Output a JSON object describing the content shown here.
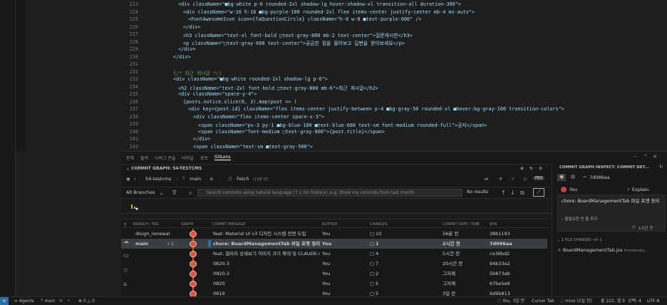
{
  "editor": {
    "lines": [
      {
        "n": "223",
        "indent": 6,
        "kind": "tagline",
        "text": "<div className=\"■bg-white p-6 rounded-2xl shadow-lg hover:shadow-xl transition-all duration-300\">"
      },
      {
        "n": "224",
        "indent": 7,
        "kind": "tagline",
        "text": "<div className=\"w-16 h-16 ■bg-purple-100 rounded-2xl flex items-center justify-center mb-4 mx-auto\">"
      },
      {
        "n": "225",
        "indent": 8,
        "kind": "tagline",
        "text": "<FontAwesomeIcon icon={faQuestionCircle} className=\"h-8 w-8 ■text-purple-600\" />"
      },
      {
        "n": "226",
        "indent": 7,
        "kind": "tagline",
        "text": "</div>"
      },
      {
        "n": "227",
        "indent": 7,
        "kind": "tagline",
        "text": "<h3 className=\"text-xl font-bold □text-gray-800 mb-2 text-center\">질문게시판</h3>"
      },
      {
        "n": "228",
        "indent": 7,
        "kind": "tagline",
        "text": "<p className=\"□text-gray-600 text-center\">궁금한 점을 물어보고 답변을 받아보세요</p>"
      },
      {
        "n": "229",
        "indent": 6,
        "kind": "tagline",
        "text": "</div>"
      },
      {
        "n": "230",
        "indent": 5,
        "kind": "tagline",
        "text": "</div>"
      },
      {
        "n": "231",
        "indent": 0,
        "kind": "blank",
        "text": ""
      },
      {
        "n": "232",
        "indent": 5,
        "kind": "comment",
        "text": "{/* 최근 게시글 */}"
      },
      {
        "n": "233",
        "indent": 5,
        "kind": "tagline",
        "text": "<div className=\"■bg-white rounded-2xl shadow-lg p-6\">"
      },
      {
        "n": "234",
        "indent": 6,
        "kind": "tagline",
        "text": "<h2 className=\"text-2xl font-bold □text-gray-800 mb-6\">최근 게시글</h2>"
      },
      {
        "n": "235",
        "indent": 6,
        "kind": "tagline",
        "text": "<div className=\"space-y-4\">"
      },
      {
        "n": "236",
        "indent": 7,
        "kind": "code",
        "text": "{posts.notice.slice(0, 3).map(post => ("
      },
      {
        "n": "237",
        "indent": 8,
        "kind": "tagline",
        "text": "<div key={post.id} className=\"flex items-center justify-between p-4 ■bg-gray-50 rounded-xl ■hover:bg-gray-100 transition-colors\">"
      },
      {
        "n": "238",
        "indent": 9,
        "kind": "tagline",
        "text": "<div className=\"flex items-center space-x-3\">"
      },
      {
        "n": "239",
        "indent": 10,
        "kind": "tagline",
        "text": "<span className=\"px-3 py-1 ■bg-blue-100 ■text-blue-600 text-sm font-medium rounded-full\">공지</span>"
      },
      {
        "n": "240",
        "indent": 10,
        "kind": "tagline",
        "text": "<span className=\"font-medium □text-gray-800\">{post.title}</span>"
      },
      {
        "n": "241",
        "indent": 9,
        "kind": "tagline",
        "text": "</div>"
      },
      {
        "n": "242",
        "indent": 9,
        "kind": "tagline",
        "text": "<span className=\"text-sm ■text-gray-500\">"
      }
    ]
  },
  "panel_tabs": [
    "문제",
    "출력",
    "디버그 콘솔",
    "터미널",
    "포트",
    "GitLens"
  ],
  "commit_graph": {
    "section_title": "COMMIT GRAPH: 54-TESTCMS",
    "repo": "54-testcms",
    "branch": "main",
    "fetch_label": "Fetch",
    "fetch_time": "(13분 전)",
    "pro_badge": "PRO",
    "branches_filter": "All Branches",
    "search_placeholder": "Search commits using natural language (↑↓ for history), e.g. Show my commits from last month",
    "results_label": "No results",
    "columns": [
      "BRANCH / TAG",
      "GRAPH",
      "COMMIT MESSAGE",
      "AUTHOR",
      "CHANGES",
      "COMMIT DATE / TIME",
      "SHA"
    ],
    "rows": [
      {
        "branch": "disign_renewal",
        "message": "feat: Material UI v3 디자인 시스템 전면 도입",
        "author": "You",
        "changes": "10",
        "date": "56분 전",
        "sha": "38b1193",
        "selected": false
      },
      {
        "branch": "main",
        "branch_extra": "+1",
        "message": "chore: BoardManagementTab 파일 포맷 정리",
        "author": "You",
        "changes": "1",
        "date": "2시간 전",
        "sha": "7d086aa",
        "selected": true
      },
      {
        "branch": "",
        "message": "feat: 갤러리 상세보기 이미지 크기 확대 및 CLAUDE.md 개",
        "author": "You",
        "changes": "4",
        "date": "5시간 전",
        "sha": "ce36bd2",
        "selected": false
      },
      {
        "branch": "",
        "message": "0820-3",
        "author": "You",
        "changes": "7",
        "date": "20시간 전",
        "sha": "94b33e2",
        "selected": false
      },
      {
        "branch": "",
        "message": "0820-2",
        "author": "You",
        "changes": "2",
        "date": "그저께",
        "sha": "5b873ab",
        "selected": false
      },
      {
        "branch": "",
        "message": "0820",
        "author": "You",
        "changes": "5",
        "date": "그저께",
        "sha": "67be5e9",
        "selected": false
      },
      {
        "branch": "",
        "message": "0819",
        "author": "You",
        "changes": "5",
        "date": "3일 전",
        "sha": "6d9b813",
        "selected": false
      }
    ]
  },
  "inspect": {
    "title": "COMMIT GRAPH INSPECT: COMMIT DET...",
    "sha": "7d086aa",
    "author": "You",
    "explain_label": "Explain",
    "message": "chore: BoardManagementTab 파일 포맷 정리",
    "bullet": "– 불필요한 빈 줄 추가",
    "time": "1시간 전",
    "files_header": "1 FILE CHANGED",
    "files_stats": "+0 -1",
    "file_name": "BoardManagementTab.jsx",
    "file_path": "frontend/s..."
  },
  "status_bar": {
    "agents": "Agents",
    "branch": "main",
    "problems": "0 △ 0",
    "blame": "You, 3일 전",
    "cursor_tab": "Cursor Tab",
    "user": "miso (2일 전)",
    "position": "줄 222, 열 9",
    "spaces": "공백: 4",
    "encoding": "UTF-8"
  },
  "colors": {
    "accent": "#2f6fa7",
    "graph_lane": "#d05a4a",
    "selected_row": "#3a3d41"
  }
}
